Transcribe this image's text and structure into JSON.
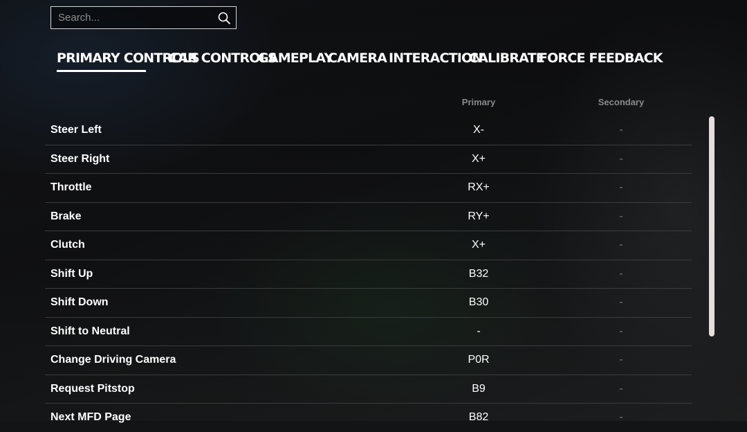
{
  "search": {
    "placeholder": "Search..."
  },
  "tabs": [
    {
      "label": "PRIMARY CONTROLS",
      "active": true
    },
    {
      "label": "CAR CONTROLS",
      "active": false
    },
    {
      "label": "GAMEPLAY",
      "active": false
    },
    {
      "label": "CAMERA",
      "active": false
    },
    {
      "label": "INTERACTION",
      "active": false
    },
    {
      "label": "CALIBRATE",
      "active": false
    },
    {
      "label": "FORCE FEEDBACK",
      "active": false
    }
  ],
  "table": {
    "headers": {
      "primary": "Primary",
      "secondary": "Secondary"
    },
    "rows": [
      {
        "name": "Steer Left",
        "primary": "X-",
        "secondary": "-"
      },
      {
        "name": "Steer Right",
        "primary": "X+",
        "secondary": "-"
      },
      {
        "name": "Throttle",
        "primary": "RX+",
        "secondary": "-"
      },
      {
        "name": "Brake",
        "primary": "RY+",
        "secondary": "-"
      },
      {
        "name": "Clutch",
        "primary": "X+",
        "secondary": "-"
      },
      {
        "name": "Shift Up",
        "primary": "B32",
        "secondary": "-"
      },
      {
        "name": "Shift Down",
        "primary": "B30",
        "secondary": "-"
      },
      {
        "name": "Shift to Neutral",
        "primary": "-",
        "secondary": "-"
      },
      {
        "name": "Change Driving Camera",
        "primary": "P0R",
        "secondary": "-"
      },
      {
        "name": "Request Pitstop",
        "primary": "B9",
        "secondary": "-"
      },
      {
        "name": "Next MFD Page",
        "primary": "B82",
        "secondary": "-"
      }
    ]
  },
  "colors": {
    "background": "#121416",
    "text": "#ffffff",
    "muted": "#8a8a8a",
    "divider": "#3a3c3e",
    "scrollbar": "#e6dede"
  }
}
